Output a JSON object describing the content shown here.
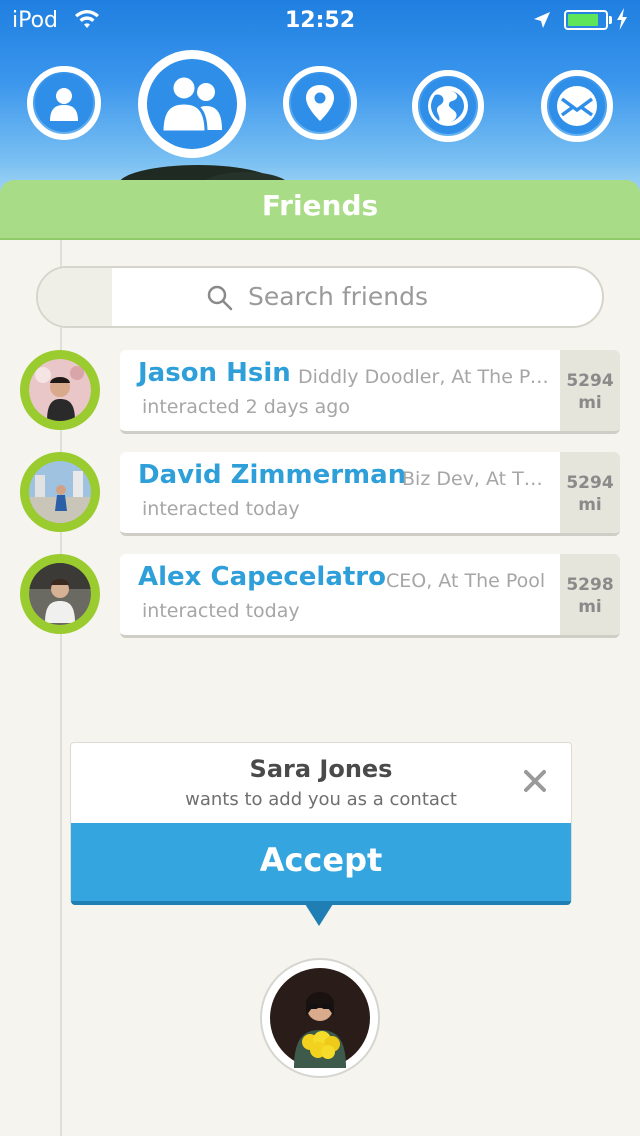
{
  "status": {
    "carrier": "iPod",
    "time": "12:52"
  },
  "header": {
    "section_title": "Friends"
  },
  "search": {
    "placeholder": "Search friends"
  },
  "friends": [
    {
      "name": "Jason Hsin",
      "title": "Diddly Doodler, At The Po...",
      "last": "interacted 2 days ago",
      "dist_value": "5294",
      "dist_unit": "mi"
    },
    {
      "name": "David Zimmerman",
      "title": "Biz Dev, At The...",
      "last": "interacted today",
      "dist_value": "5294",
      "dist_unit": "mi"
    },
    {
      "name": "Alex Capecelatro",
      "title": "CEO, At The Pool",
      "last": "interacted today",
      "dist_value": "5298",
      "dist_unit": "mi"
    }
  ],
  "request": {
    "name": "Sara Jones",
    "message": "wants to add you as a contact",
    "accept_label": "Accept"
  },
  "colors": {
    "accent": "#34a5df",
    "friends_bar": "#a9dc86",
    "avatar_ring": "#9acb2f"
  }
}
